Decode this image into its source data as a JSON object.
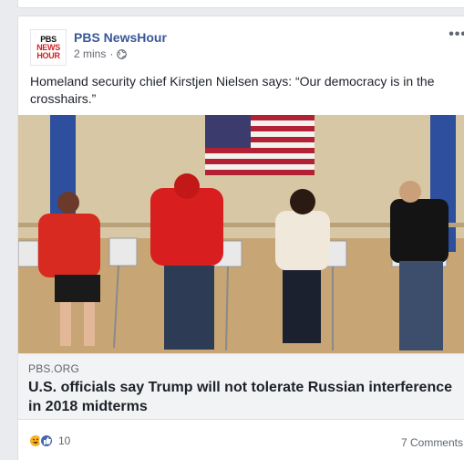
{
  "post": {
    "page_name": "PBS NewsHour",
    "logo": {
      "line1": "PBS",
      "line2": "NEWS",
      "line3": "HOUR"
    },
    "timestamp": "2 mins",
    "separator": "·",
    "privacy_icon": "globe-icon",
    "more_label": "•••",
    "caption": "Homeland security chief Kirstjen Nielsen says: “Our democracy is in the crosshairs.”"
  },
  "link": {
    "domain": "PBS.ORG",
    "headline": "U.S. officials say Trump will not tolerate Russian interference in 2018 midterms"
  },
  "footer": {
    "reaction_icons": [
      "haha-icon",
      "like-icon"
    ],
    "reaction_count": "10",
    "comments": "7 Comments"
  },
  "colors": {
    "page_name": "#385898",
    "like_blue": "#4267b2",
    "logo_red": "#d42020"
  }
}
